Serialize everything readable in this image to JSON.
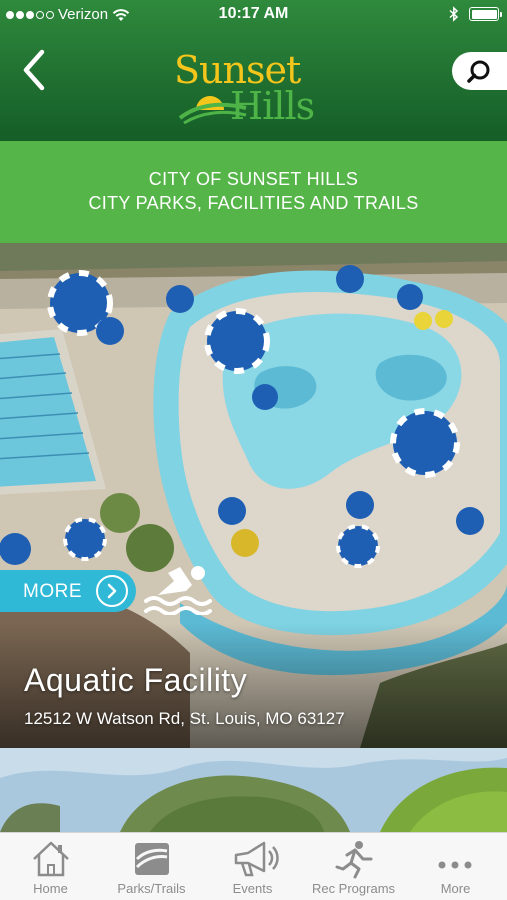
{
  "status_bar": {
    "carrier": "Verizon",
    "time": "10:17 AM",
    "signal_bars_filled": 3,
    "signal_bars_total": 5
  },
  "header": {
    "logo_line1": "Sunset",
    "logo_line2": "Hills",
    "back_icon": "chevron-left-icon",
    "search_icon": "search-icon"
  },
  "banner": {
    "line1": "CITY OF SUNSET HILLS",
    "line2": "CITY PARKS, FACILITIES AND TRAILS"
  },
  "feature": {
    "more_label": "MORE",
    "category_icon": "swimmer-icon",
    "title": "Aquatic Facility",
    "address": "12512 W Watson Rd, St. Louis, MO 63127"
  },
  "tabs": [
    {
      "label": "Home",
      "icon": "home-icon"
    },
    {
      "label": "Parks/Trails",
      "icon": "parks-trails-icon"
    },
    {
      "label": "Events",
      "icon": "megaphone-icon"
    },
    {
      "label": "Rec Programs",
      "icon": "runner-icon"
    },
    {
      "label": "More",
      "icon": "ellipsis-icon"
    }
  ],
  "colors": {
    "header_green": "#1f6e30",
    "banner_green": "#55b548",
    "logo_gold": "#f4c51b",
    "logo_green": "#4fb447",
    "more_button": "#2fb9d6",
    "tab_text": "#8c8c8c"
  }
}
